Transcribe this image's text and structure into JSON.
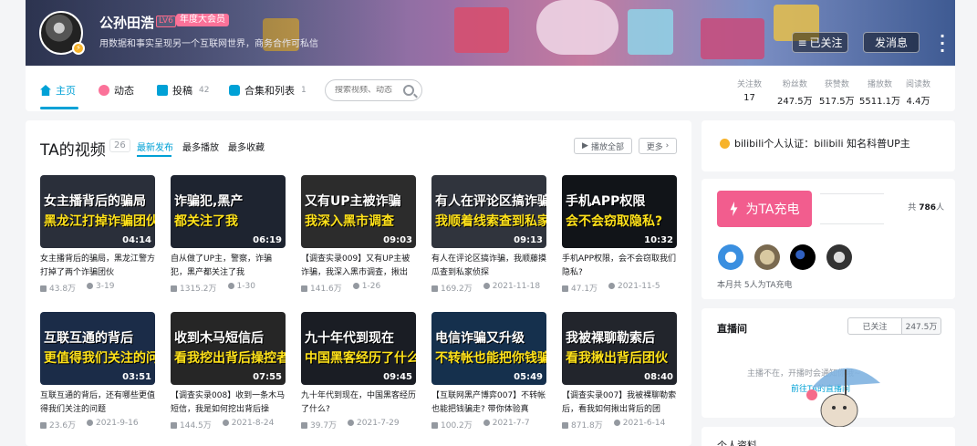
{
  "user": {
    "name": "公孙田浩",
    "level": "LV6",
    "vip": "年度大会员",
    "sign": "用数据和事实呈现另一个互联网世界，商务合作可私信"
  },
  "header": {
    "follow_label": "已关注",
    "message_label": "发消息"
  },
  "nav": [
    {
      "label": "主页",
      "count": ""
    },
    {
      "label": "动态",
      "count": ""
    },
    {
      "label": "投稿",
      "count": "42"
    },
    {
      "label": "合集和列表",
      "count": "1"
    }
  ],
  "search": {
    "placeholder": "搜索视频、动态"
  },
  "stats": [
    {
      "key": "关注数",
      "value": "17"
    },
    {
      "key": "粉丝数",
      "value": "247.5万"
    },
    {
      "key": "获赞数",
      "value": "517.5万"
    },
    {
      "key": "播放数",
      "value": "5511.1万"
    },
    {
      "key": "阅读数",
      "value": "4.4万"
    }
  ],
  "videos_section": {
    "title": "TA的视频",
    "count": "26",
    "sorts": [
      "最新发布",
      "最多播放",
      "最多收藏"
    ],
    "play_all": "播放全部",
    "more": "更多"
  },
  "videos": [
    {
      "thumb_line1": "女主播背后的骗局",
      "thumb_line2": "黑龙江打掉诈骗团伙",
      "duration": "04:14",
      "title": "女主播背后的骗局，黑龙江警方打掉了两个诈骗团伙",
      "plays": "43.8万",
      "date": "3-19"
    },
    {
      "thumb_line1": "诈骗犯,黑产",
      "thumb_line2": "都关注了我",
      "duration": "06:19",
      "title": "自从做了UP主，警察，诈骗犯，黑产都关注了我",
      "plays": "1315.2万",
      "date": "1-30"
    },
    {
      "thumb_line1": "又有UP主被诈骗",
      "thumb_line2": "我深入黑市调查",
      "duration": "09:03",
      "title": "【调查实录009】又有UP主被诈骗，我深入黑市调查，揪出",
      "plays": "141.6万",
      "date": "1-26"
    },
    {
      "thumb_line1": "有人在评论区搞诈骗",
      "thumb_line2": "我顺着线索查到私家侦探",
      "duration": "09:13",
      "title": "有人在评论区搞诈骗，我顺藤摸瓜查到私家侦探",
      "plays": "169.2万",
      "date": "2021-11-18"
    },
    {
      "thumb_line1": "手机APP权限",
      "thumb_line2": "会不会窃取隐私?",
      "duration": "10:32",
      "title": "手机APP权限，会不会窃取我们隐私?",
      "plays": "47.1万",
      "date": "2021-11-5"
    },
    {
      "thumb_line1": "互联互通的背后",
      "thumb_line2": "更值得我们关注的问题",
      "duration": "03:51",
      "title": "互联互通的背后，还有哪些更值得我们关注的问题",
      "plays": "23.6万",
      "date": "2021-9-16"
    },
    {
      "thumb_line1": "收到木马短信后",
      "thumb_line2": "看我挖出背后操控者",
      "duration": "07:55",
      "title": "【调查实录008】收到一条木马短信，我是如何挖出背后操",
      "plays": "144.5万",
      "date": "2021-8-24"
    },
    {
      "thumb_line1": "九十年代到现在",
      "thumb_line2": "中国黑客经历了什么",
      "duration": "09:45",
      "title": "九十年代到现在，中国黑客经历了什么?",
      "plays": "39.7万",
      "date": "2021-7-29"
    },
    {
      "thumb_line1": "电信诈骗又升级",
      "thumb_line2": "不转帐也能把你钱骗走",
      "duration": "05:49",
      "title": "【互联网黑产博弈007】不转帐也能把钱骗走? 带你体验真",
      "plays": "100.2万",
      "date": "2021-7-7"
    },
    {
      "thumb_line1": "我被裸聊勒索后",
      "thumb_line2": "看我揪出背后团伙",
      "duration": "08:40",
      "title": "【调查实录007】我被裸聊勒索后，看我如何揪出背后的团",
      "plays": "871.8万",
      "date": "2021-6-14"
    }
  ],
  "certification": {
    "text": "bilibili个人认证：bilibili 知名科普UP主"
  },
  "charge": {
    "button": "为TA充电",
    "total_prefix": "共",
    "total": "786",
    "total_suffix": "人",
    "footer": "本月共 5人为TA充电"
  },
  "live": {
    "title": "直播间",
    "follow": "已关注",
    "followers": "247.5万",
    "message": "主播不在，开播时会通知你哦~",
    "link": "前往TA的直播间"
  },
  "profile": {
    "title": "个人资料"
  },
  "colors": {
    "accent": "#00a1d6",
    "pink": "#fb7299",
    "charge": "#f25d8e"
  }
}
